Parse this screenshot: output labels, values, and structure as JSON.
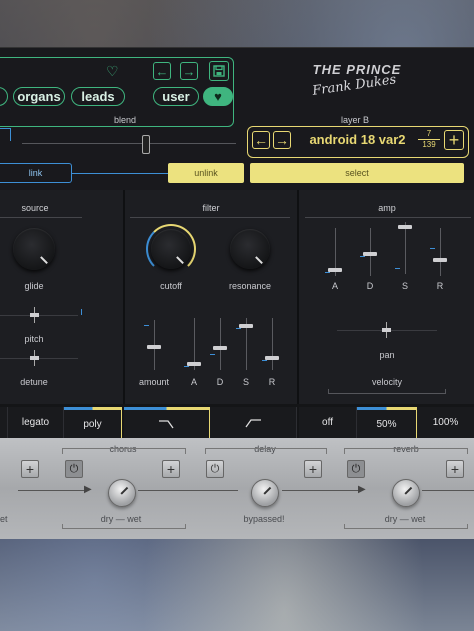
{
  "header": {
    "logo_title": "THE PRINCE",
    "logo_signature": "Frank Dukes",
    "categories": [
      "organs",
      "leads",
      "user"
    ]
  },
  "blend": {
    "label": "blend",
    "link_label": "link"
  },
  "layer_b": {
    "label": "layer B",
    "preset_name": "android 18 var2",
    "preset_index": "7",
    "preset_total": "139",
    "unlink_label": "unlink",
    "select_label": "select"
  },
  "source": {
    "title": "source",
    "glide_label": "glide",
    "pitch_label": "pitch",
    "detune_label": "detune"
  },
  "filter": {
    "title": "filter",
    "cutoff_label": "cutoff",
    "resonance_label": "resonance",
    "amount_label": "amount",
    "adsr_labels": [
      "A",
      "D",
      "S",
      "R"
    ]
  },
  "amp": {
    "title": "amp",
    "adsr_labels": [
      "A",
      "D",
      "S",
      "R"
    ],
    "pan_label": "pan",
    "velocity_label": "velocity"
  },
  "tabs": {
    "legato": "legato",
    "poly": "poly",
    "velocity_options": [
      "off",
      "50%",
      "100%"
    ]
  },
  "fx": {
    "chorus": {
      "title": "chorus",
      "knob_label": "dry — wet"
    },
    "delay": {
      "title": "delay",
      "knob_label": "bypassed!"
    },
    "reverb": {
      "title": "reverb",
      "knob_label": "dry — wet"
    },
    "left_cut_label": "et"
  },
  "colors": {
    "green": "#3fb57f",
    "yellow": "#e8d873",
    "blue": "#3d8fd6"
  }
}
